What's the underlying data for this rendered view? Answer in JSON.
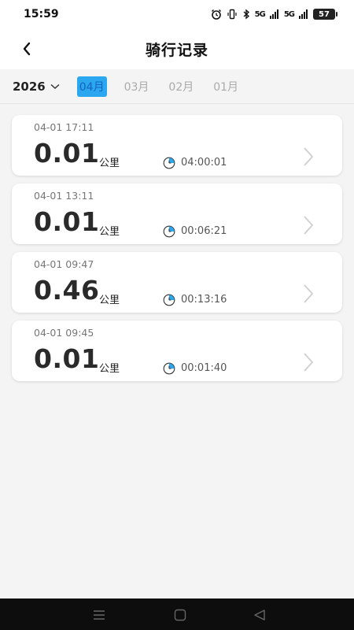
{
  "status_bar": {
    "time": "15:59",
    "signal1_label": "5G",
    "signal2_label": "5G",
    "battery": "57"
  },
  "header": {
    "title": "骑行记录",
    "back_icon": "chevron-left-icon"
  },
  "filter": {
    "year": "2026",
    "months": [
      {
        "label": "04月",
        "active": true
      },
      {
        "label": "03月",
        "active": false
      },
      {
        "label": "02月",
        "active": false
      },
      {
        "label": "01月",
        "active": false
      }
    ]
  },
  "records": [
    {
      "datetime": "04-01 17:11",
      "distance": "0.01",
      "unit": "公里",
      "duration": "04:00:01"
    },
    {
      "datetime": "04-01 13:11",
      "distance": "0.01",
      "unit": "公里",
      "duration": "00:06:21"
    },
    {
      "datetime": "04-01 09:47",
      "distance": "0.46",
      "unit": "公里",
      "duration": "00:13:16"
    },
    {
      "datetime": "04-01 09:45",
      "distance": "0.01",
      "unit": "公里",
      "duration": "00:01:40"
    }
  ],
  "colors": {
    "accent": "#2aa7ef",
    "background": "#f4f4f4",
    "card": "#ffffff"
  }
}
